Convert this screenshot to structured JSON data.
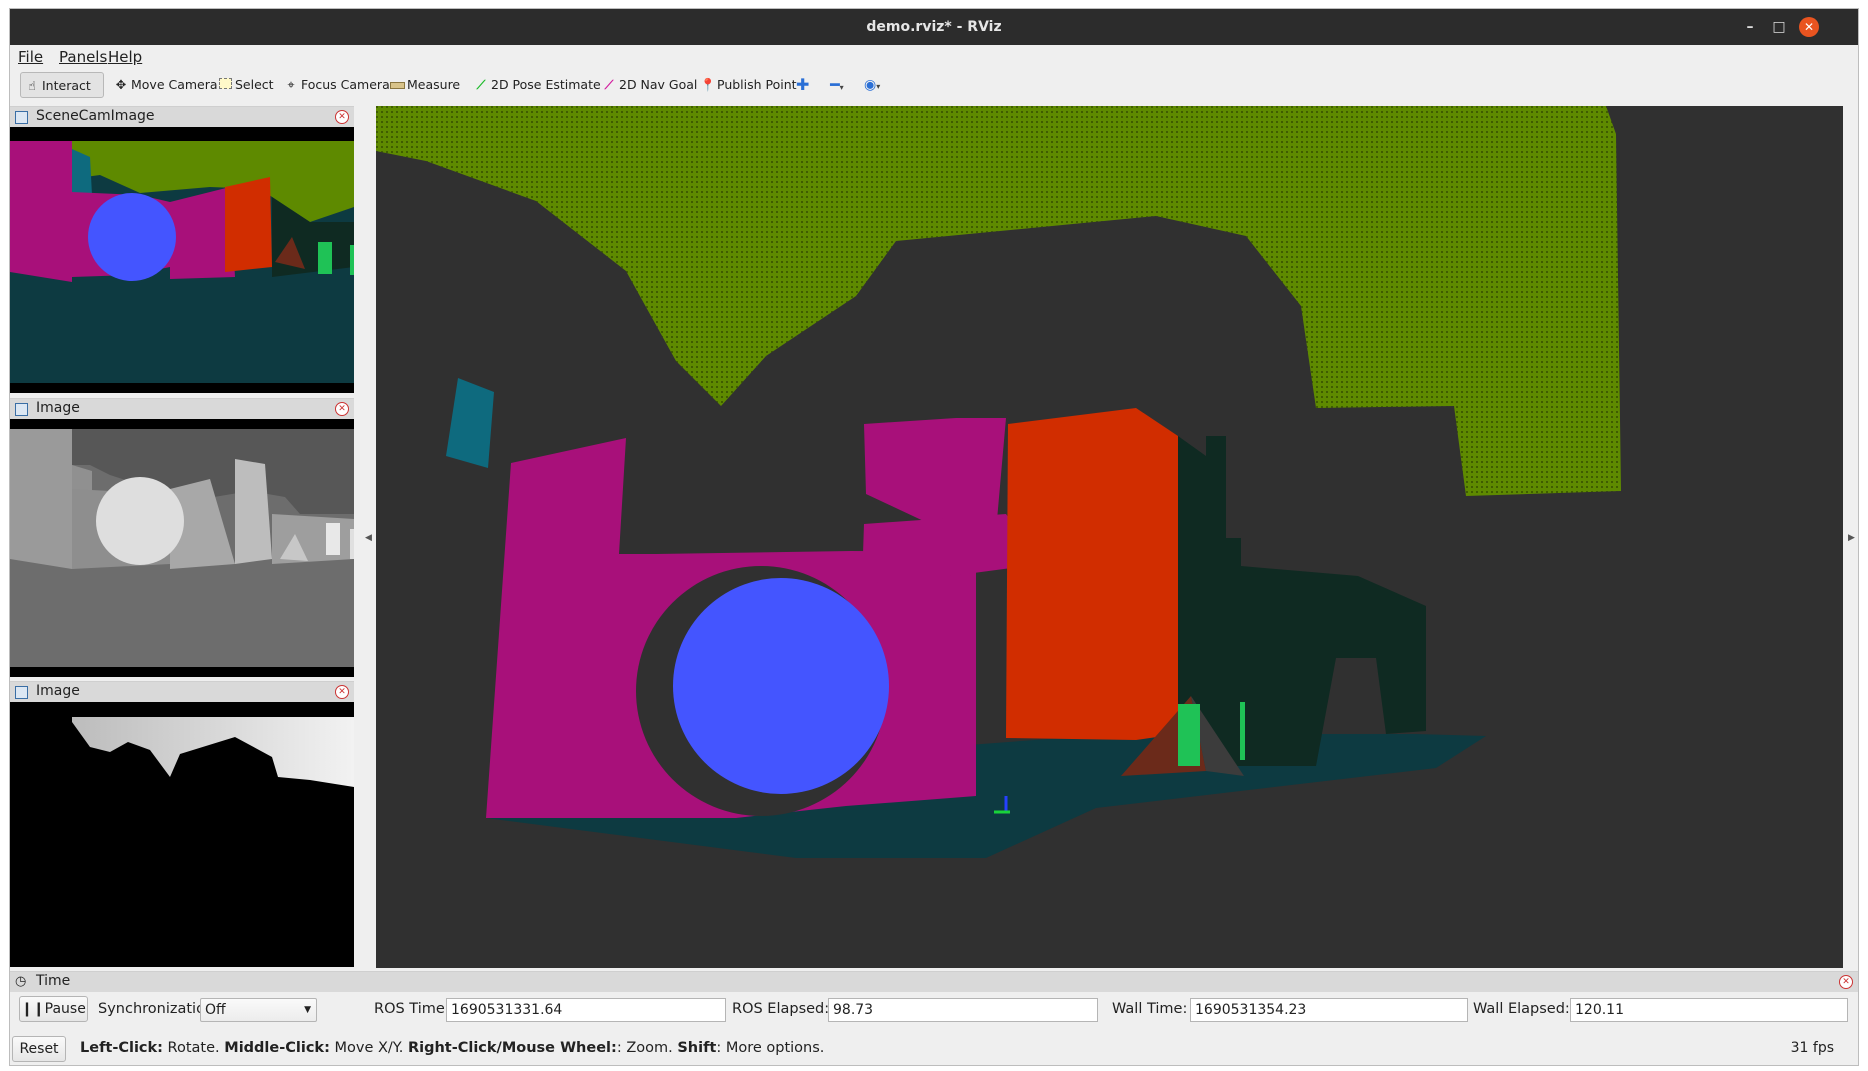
{
  "window": {
    "title": "demo.rviz* - RViz",
    "minimize": "–",
    "maximize": "□",
    "close": "✕"
  },
  "menu": {
    "file": "File",
    "panels": "Panels",
    "help": "Help"
  },
  "toolbar": {
    "interact": "Interact",
    "move_camera": "Move Camera",
    "select": "Select",
    "focus_camera": "Focus Camera",
    "measure": "Measure",
    "pose_estimate": "2D Pose Estimate",
    "nav_goal": "2D Nav Goal",
    "publish_point": "Publish Point"
  },
  "panels": {
    "scene_cam": {
      "title": "SceneCamImage"
    },
    "image1": {
      "title": "Image"
    },
    "image2": {
      "title": "Image"
    }
  },
  "time_panel": {
    "title": "Time",
    "pause_label": "Pause",
    "sync_label": "Synchronization:",
    "sync_value": "Off",
    "ros_time_label": "ROS Time:",
    "ros_time_value": "1690531331.64",
    "ros_elapsed_label": "ROS Elapsed:",
    "ros_elapsed_value": "98.73",
    "wall_time_label": "Wall Time:",
    "wall_time_value": "1690531354.23",
    "wall_elapsed_label": "Wall Elapsed:",
    "wall_elapsed_value": "120.11"
  },
  "status_bar": {
    "reset_label": "Reset",
    "left_click": "Left-Click:",
    "left_click_text": " Rotate. ",
    "middle_click": "Middle-Click:",
    "middle_click_text": " Move X/Y. ",
    "right_click": "Right-Click/Mouse Wheel:",
    "right_click_text": ": Zoom. ",
    "shift": "Shift",
    "shift_text": ": More options.",
    "fps": "31 fps"
  },
  "colors": {
    "ceiling_green": "#5e8a00",
    "magenta": "#a8107a",
    "orange_red": "#d12d00",
    "sphere_blue": "#4455ff",
    "floor_teal": "#0d3a41",
    "dark_green_block": "#0f2a22",
    "bright_green": "#1fc256",
    "background": "#303030"
  }
}
